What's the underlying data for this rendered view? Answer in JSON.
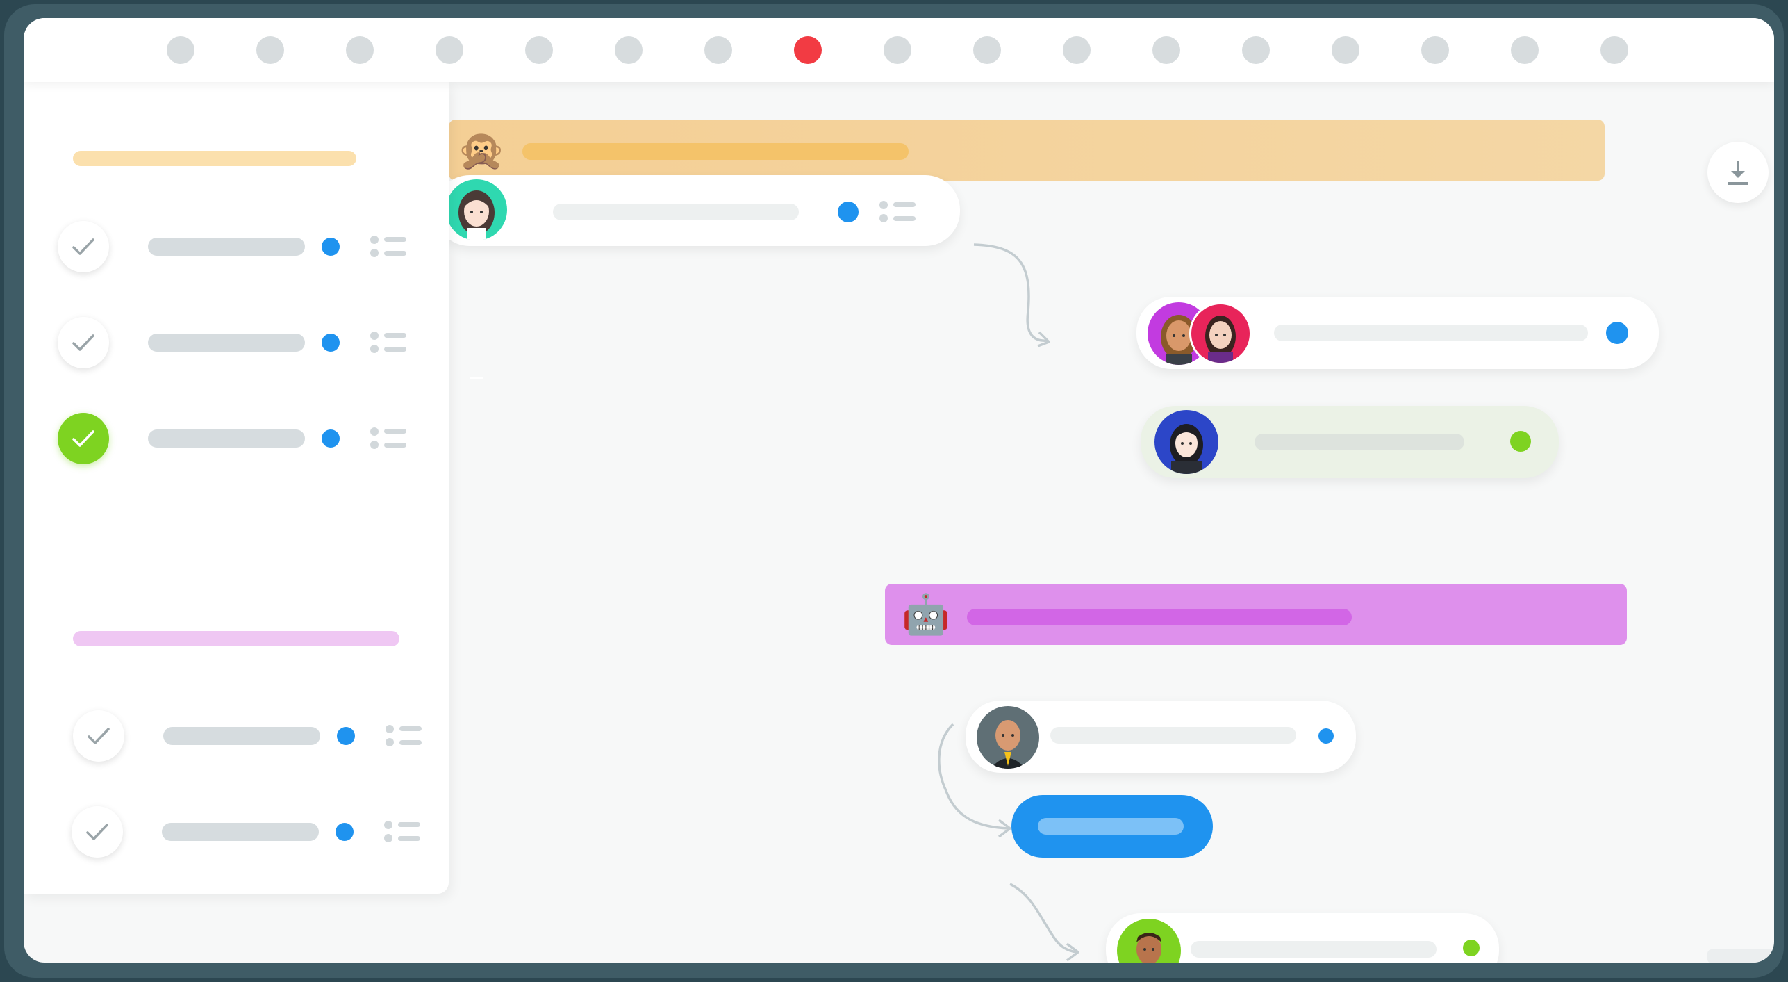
{
  "window": {
    "timeline": {
      "steps": 17,
      "active_index": 7,
      "colors": {
        "inactive": "#d7dcde",
        "active": "#f23b43"
      }
    },
    "sidebar": {
      "sections": [
        {
          "name": "section-1",
          "title_color": "#fbe0ad",
          "tasks": [
            {
              "completed": false,
              "status_color": "#1f93ef"
            },
            {
              "completed": false,
              "status_color": "#1f93ef"
            },
            {
              "completed": true,
              "status_color": "#1f93ef"
            }
          ]
        },
        {
          "name": "section-2",
          "title_color": "#efc7f3",
          "tasks": [
            {
              "completed": false,
              "status_color": "#1f93ef"
            },
            {
              "completed": false,
              "status_color": "#1f93ef"
            }
          ]
        }
      ]
    },
    "flow": {
      "groups": [
        {
          "emoji": "🙊",
          "icon": "see-no-evil-monkey-icon",
          "color": "#f4d39e",
          "accent": "#f4c36a"
        },
        {
          "emoji": "🤖",
          "icon": "robot-icon",
          "color": "#de90ec",
          "accent": "#d266e6"
        }
      ],
      "messages": [
        {
          "avatar": "woman-avatar",
          "status_color": "#1f93ef",
          "has_list_icon": true
        },
        {
          "avatar": "two-women-avatar",
          "status_color": "#1f93ef"
        },
        {
          "avatar": "woman-dark-hair-avatar",
          "status_color": "#7ed321",
          "highlight": "#ebf2e6"
        },
        {
          "avatar": "bald-man-avatar",
          "status_color": "#1f93ef"
        },
        {
          "avatar": "man-green-avatar",
          "status_color": "#7ed321"
        }
      ],
      "reply_button_color": "#1f93ef"
    },
    "download_icon": "download-icon"
  }
}
